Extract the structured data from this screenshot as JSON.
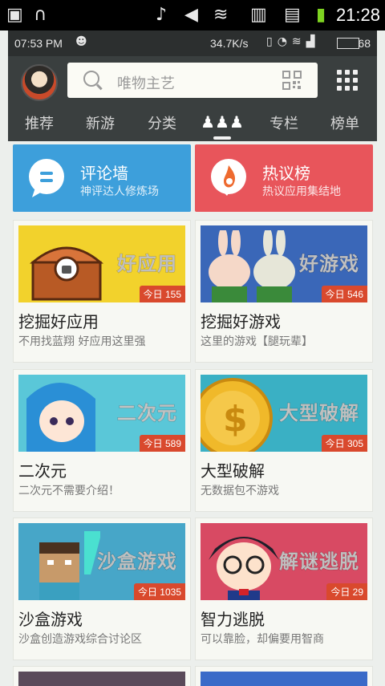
{
  "system_bar": {
    "time": "21:28",
    "icons": [
      "image-icon",
      "headset-icon",
      "music-note-icon",
      "mute-icon",
      "wifi-icon",
      "phone-storage-icon",
      "sd-card-icon",
      "battery-charging-icon"
    ]
  },
  "inner_status": {
    "time": "07:53 PM",
    "speed": "34.7K/s",
    "battery": "68"
  },
  "header": {
    "search_placeholder": "唯物主艺"
  },
  "tabs": [
    {
      "label": "推荐"
    },
    {
      "label": "新游"
    },
    {
      "label": "分类"
    },
    {
      "label": "",
      "icon": "community-icon"
    },
    {
      "label": "专栏"
    },
    {
      "label": "榜单"
    }
  ],
  "banners": [
    {
      "title": "评论墙",
      "subtitle": "神评达人修炼场",
      "color": "#3d9fdb"
    },
    {
      "title": "热议榜",
      "subtitle": "热议应用集结地",
      "color": "#e8555b"
    }
  ],
  "cards": [
    {
      "title": "挖掘好应用",
      "subtitle": "不用找蓝翔 好应用这里强",
      "badge": "今日 155",
      "overlay": "好应用",
      "bg": "#f2d22c"
    },
    {
      "title": "挖掘好游戏",
      "subtitle": "这里的游戏【腿玩辈】",
      "badge": "今日 546",
      "overlay": "好游戏",
      "bg": "#3a67b8"
    },
    {
      "title": "二次元",
      "subtitle": "二次元不需要介绍！",
      "badge": "今日 589",
      "overlay": "二次元",
      "bg": "#5ac7d8"
    },
    {
      "title": "大型破解",
      "subtitle": "无数据包不游戏",
      "badge": "今日 305",
      "overlay": "大型破解",
      "bg": "#3ab0c4"
    },
    {
      "title": "沙盒游戏",
      "subtitle": "沙盒创造游戏综合讨论区",
      "badge": "今日 1035",
      "overlay": "沙盒游戏",
      "bg": "#47a6c8"
    },
    {
      "title": "智力逃脱",
      "subtitle": "可以靠脸，却偏要用智商",
      "badge": "今日 29",
      "overlay": "解谜逃脱",
      "bg": "#d84a63"
    }
  ]
}
